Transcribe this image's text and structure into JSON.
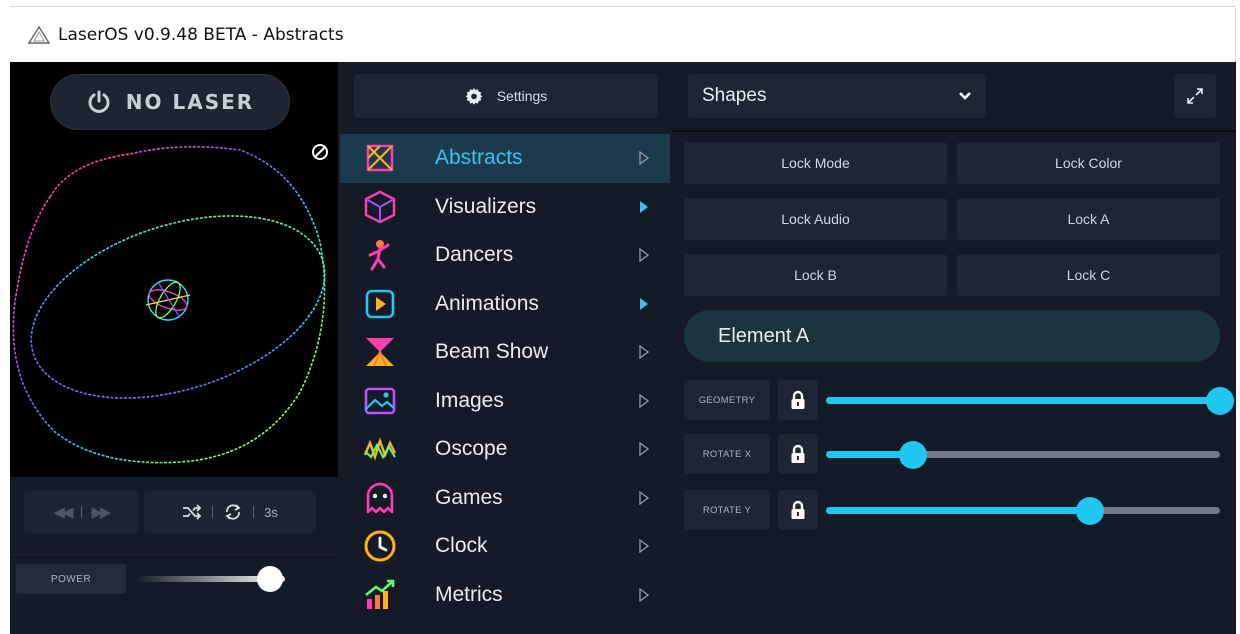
{
  "window": {
    "title": "LaserOS v0.9.48 BETA - Abstracts"
  },
  "left": {
    "laser_button": "NO LASER",
    "transport": {
      "loop_duration": "3s"
    },
    "power": {
      "label": "POWER",
      "level": 0.9
    }
  },
  "middle": {
    "settings_label": "Settings",
    "menu": [
      {
        "label": "Abstracts",
        "icon": "abstracts-icon",
        "active": true,
        "arrow": "outline"
      },
      {
        "label": "Visualizers",
        "icon": "visualizers-icon",
        "active": false,
        "arrow": "filled"
      },
      {
        "label": "Dancers",
        "icon": "dancers-icon",
        "active": false,
        "arrow": "outline"
      },
      {
        "label": "Animations",
        "icon": "animations-icon",
        "active": false,
        "arrow": "filled"
      },
      {
        "label": "Beam Show",
        "icon": "beam-show-icon",
        "active": false,
        "arrow": "outline"
      },
      {
        "label": "Images",
        "icon": "images-icon",
        "active": false,
        "arrow": "outline"
      },
      {
        "label": "Oscope",
        "icon": "oscope-icon",
        "active": false,
        "arrow": "outline"
      },
      {
        "label": "Games",
        "icon": "games-icon",
        "active": false,
        "arrow": "outline"
      },
      {
        "label": "Clock",
        "icon": "clock-icon",
        "active": false,
        "arrow": "outline"
      },
      {
        "label": "Metrics",
        "icon": "metrics-icon",
        "active": false,
        "arrow": "outline"
      }
    ]
  },
  "right": {
    "dropdown_value": "Shapes",
    "locks": [
      "Lock Mode",
      "Lock Color",
      "Lock Audio",
      "Lock A",
      "Lock B",
      "Lock C"
    ],
    "element_title": "Element A",
    "params": [
      {
        "label": "GEOMETRY",
        "value": 1.0
      },
      {
        "label": "ROTATE X",
        "value": 0.22
      },
      {
        "label": "ROTATE Y",
        "value": 0.67
      }
    ]
  },
  "colors": {
    "accent": "#1ec8f3",
    "active_row": "#1c3a4e",
    "panel": "#141b26",
    "button": "#1e2633"
  }
}
